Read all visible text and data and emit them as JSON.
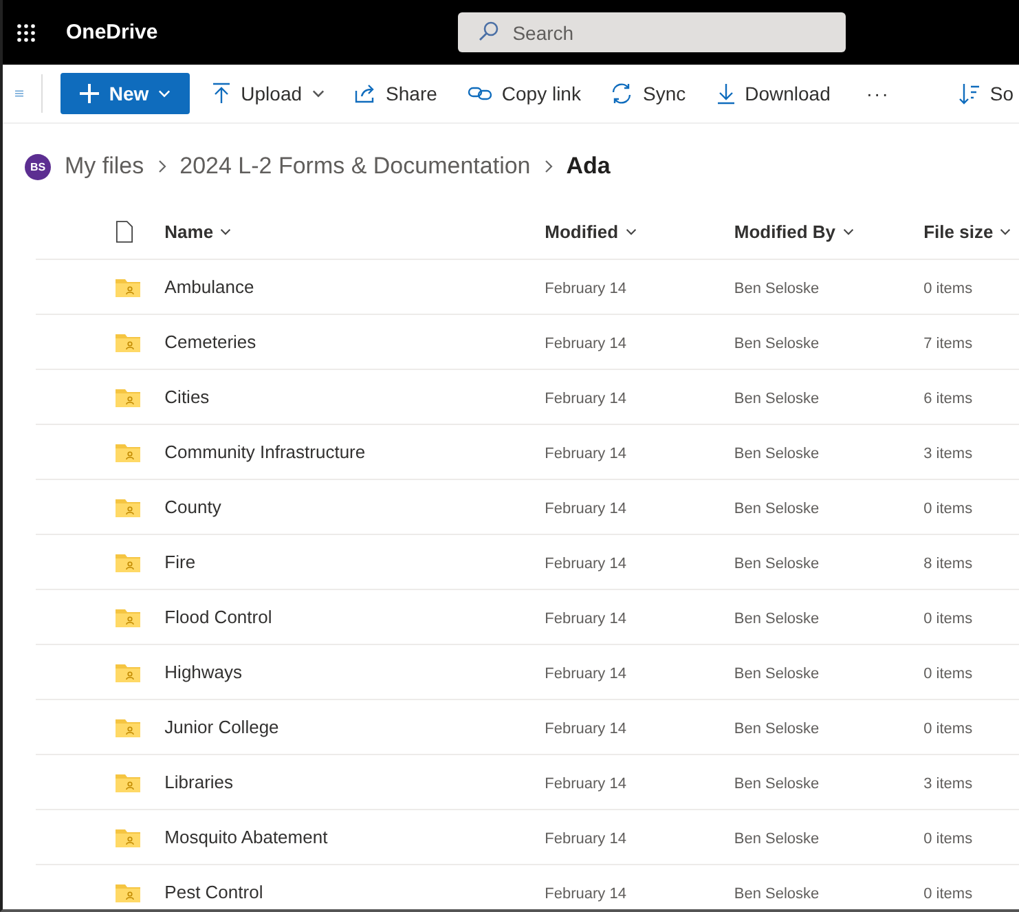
{
  "app": {
    "name": "OneDrive"
  },
  "search": {
    "placeholder": "Search"
  },
  "toolbar": [
    {
      "kind": "new",
      "label": "New",
      "caret": true
    },
    {
      "kind": "upload",
      "label": "Upload",
      "caret": true
    },
    {
      "kind": "share",
      "label": "Share",
      "caret": false
    },
    {
      "kind": "link",
      "label": "Copy link",
      "caret": false
    },
    {
      "kind": "sync",
      "label": "Sync",
      "caret": false
    },
    {
      "kind": "download",
      "label": "Download",
      "caret": false
    },
    {
      "kind": "more",
      "label": "···",
      "caret": false
    },
    {
      "kind": "sort",
      "label": "So",
      "caret": false
    }
  ],
  "breadcrumb": {
    "avatar": "BS",
    "items": [
      {
        "label": "My files",
        "current": false
      },
      {
        "label": "2024 L-2 Forms & Documentation",
        "current": false
      },
      {
        "label": "Ada",
        "current": true
      }
    ]
  },
  "table": {
    "columns": [
      "Name",
      "Modified",
      "Modified By",
      "File size"
    ],
    "rows": [
      {
        "name": "Ambulance",
        "modified": "February 14",
        "modified_by": "Ben Seloske",
        "size": "0 items"
      },
      {
        "name": "Cemeteries",
        "modified": "February 14",
        "modified_by": "Ben Seloske",
        "size": "7 items"
      },
      {
        "name": "Cities",
        "modified": "February 14",
        "modified_by": "Ben Seloske",
        "size": "6 items"
      },
      {
        "name": "Community Infrastructure",
        "modified": "February 14",
        "modified_by": "Ben Seloske",
        "size": "3 items"
      },
      {
        "name": "County",
        "modified": "February 14",
        "modified_by": "Ben Seloske",
        "size": "0 items"
      },
      {
        "name": "Fire",
        "modified": "February 14",
        "modified_by": "Ben Seloske",
        "size": "8 items"
      },
      {
        "name": "Flood Control",
        "modified": "February 14",
        "modified_by": "Ben Seloske",
        "size": "0 items"
      },
      {
        "name": "Highways",
        "modified": "February 14",
        "modified_by": "Ben Seloske",
        "size": "0 items"
      },
      {
        "name": "Junior College",
        "modified": "February 14",
        "modified_by": "Ben Seloske",
        "size": "0 items"
      },
      {
        "name": "Libraries",
        "modified": "February 14",
        "modified_by": "Ben Seloske",
        "size": "3 items"
      },
      {
        "name": "Mosquito Abatement",
        "modified": "February 14",
        "modified_by": "Ben Seloske",
        "size": "0 items"
      },
      {
        "name": "Pest Control",
        "modified": "February 14",
        "modified_by": "Ben Seloske",
        "size": "0 items"
      }
    ]
  }
}
